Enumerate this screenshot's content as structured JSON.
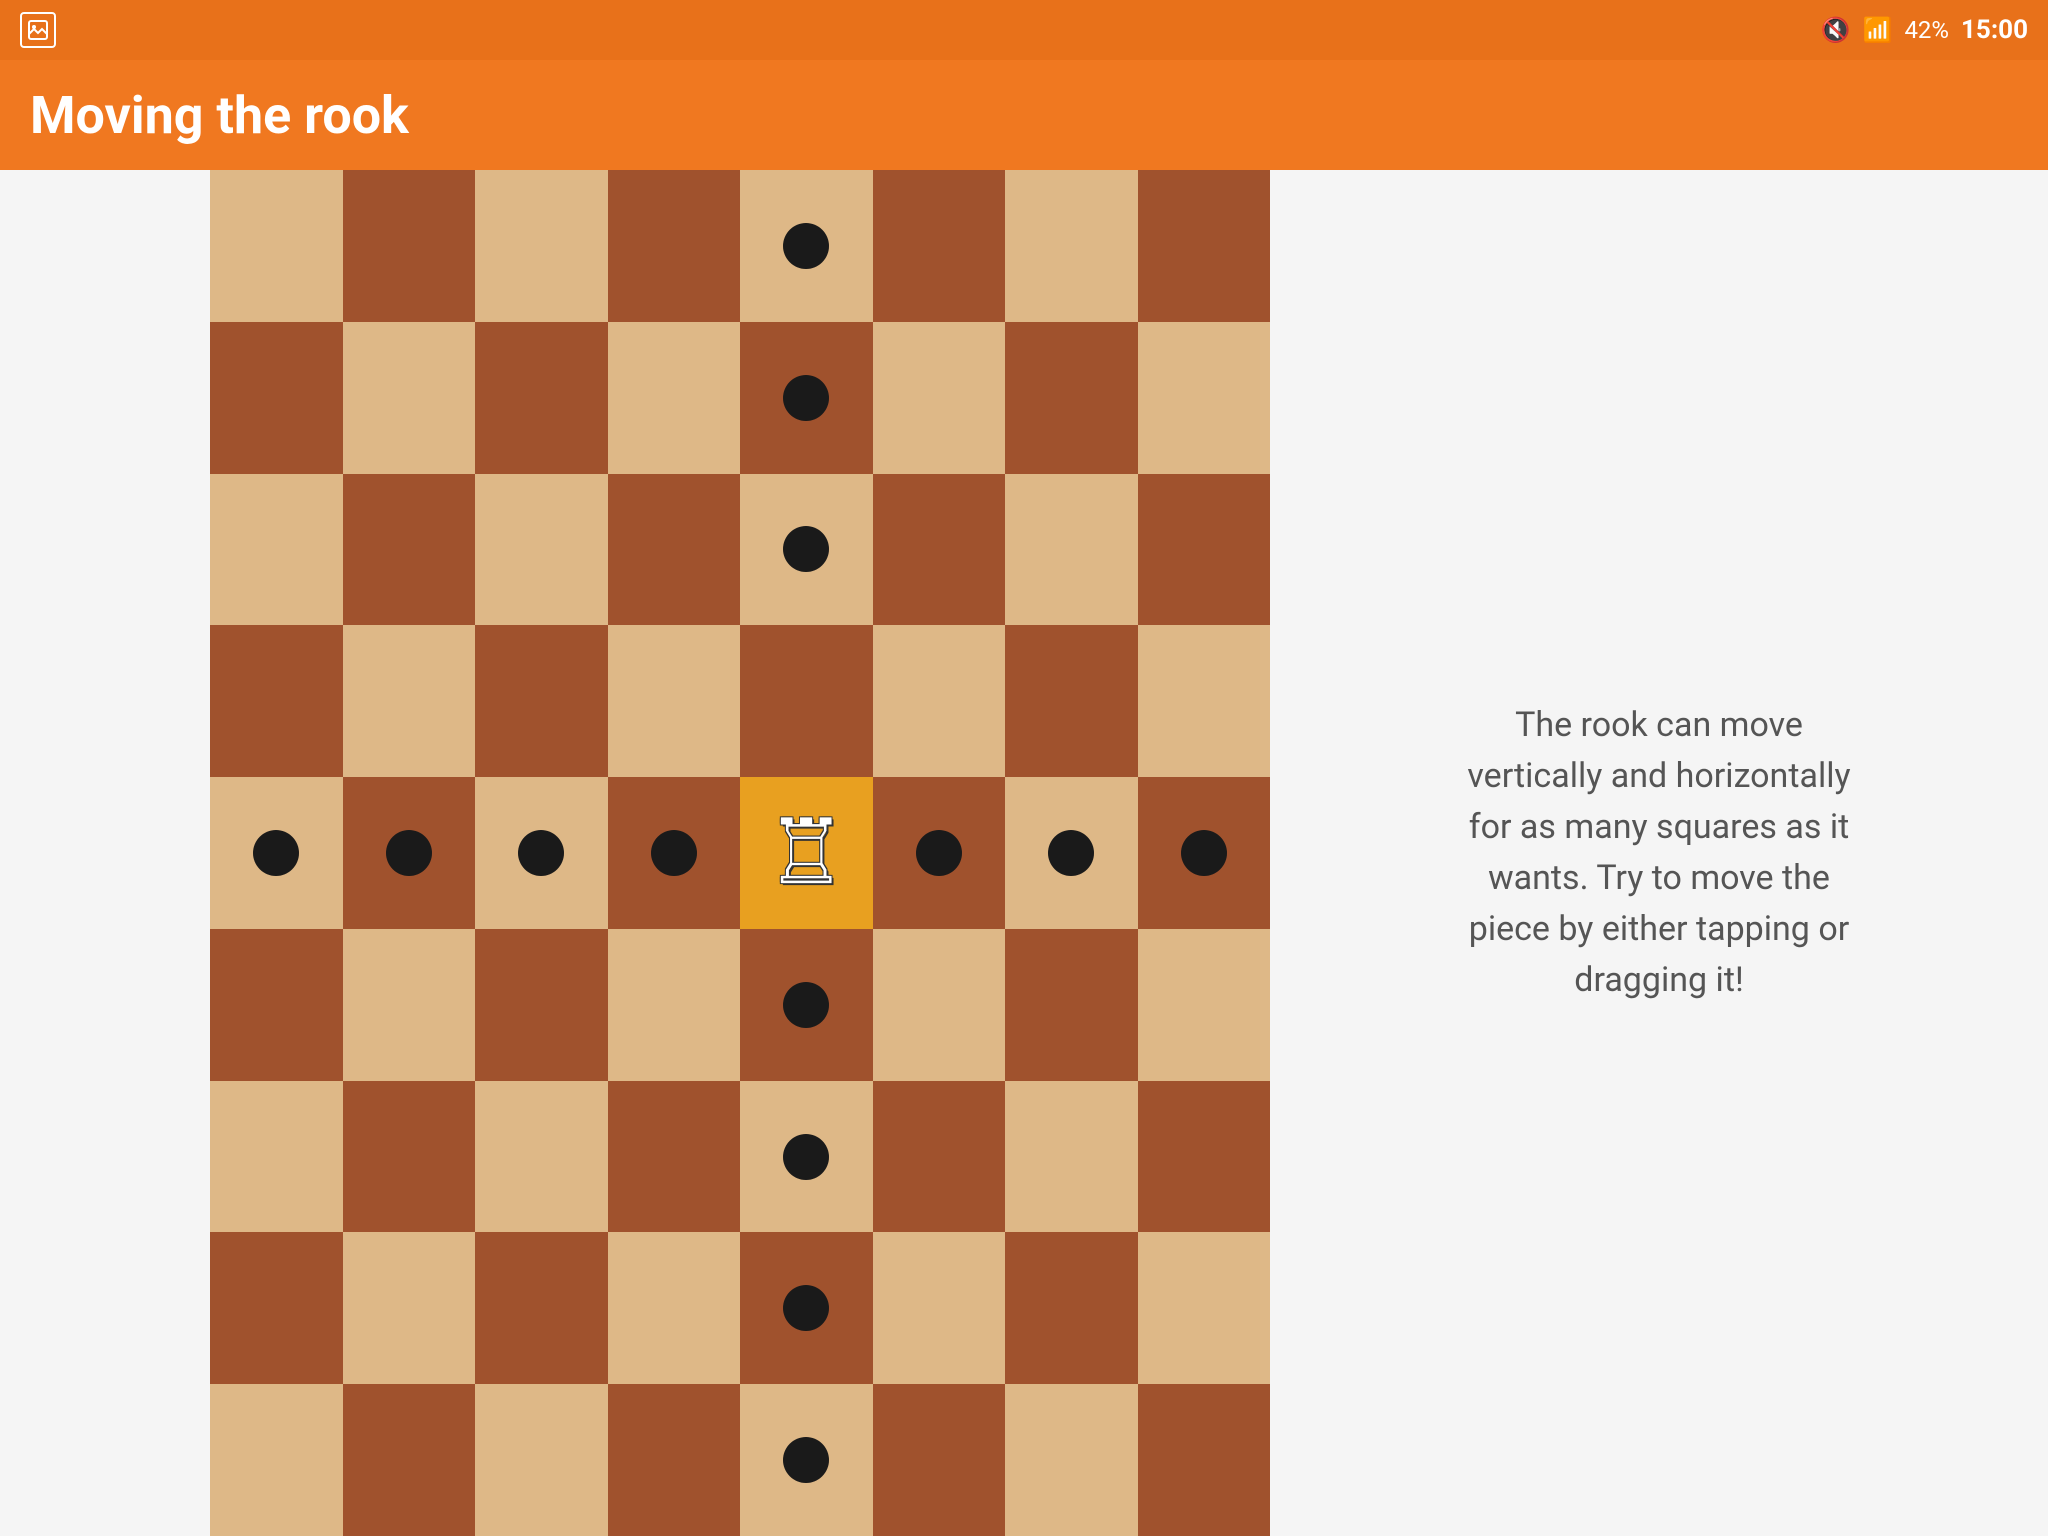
{
  "status_bar": {
    "battery": "42%",
    "time": "15:00"
  },
  "app_bar": {
    "title": "Moving the rook"
  },
  "info_panel": {
    "description": "The rook can move vertically and horizontally for as many squares as it wants. Try to move the piece by either tapping or dragging it!"
  },
  "board": {
    "rows": 9,
    "cols": 8,
    "rook_row": 4,
    "rook_col": 4,
    "highlighted_row": 4,
    "highlighted_col": 4,
    "move_dots": [
      [
        0,
        4
      ],
      [
        1,
        4
      ],
      [
        2,
        4
      ],
      [
        4,
        0
      ],
      [
        4,
        1
      ],
      [
        4,
        2
      ],
      [
        4,
        3
      ],
      [
        4,
        5
      ],
      [
        4,
        6
      ],
      [
        4,
        7
      ],
      [
        5,
        4
      ],
      [
        6,
        4
      ],
      [
        7,
        4
      ],
      [
        8,
        4
      ]
    ]
  }
}
